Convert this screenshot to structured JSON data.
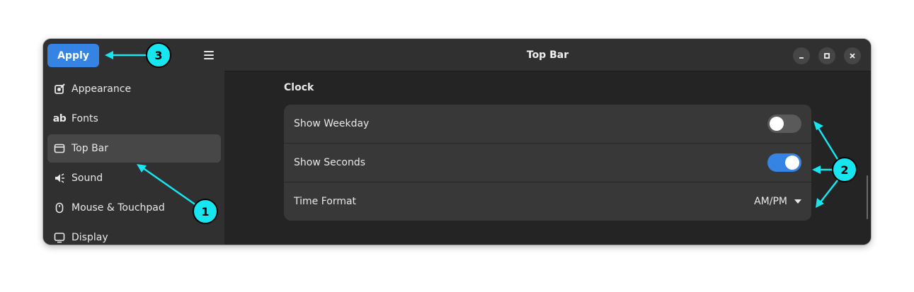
{
  "sidebar": {
    "apply_label": "Apply",
    "menu_icon": "hamburger-menu-icon",
    "items": [
      {
        "label": "Appearance",
        "icon": "appearance-icon"
      },
      {
        "label": "Fonts",
        "icon": "fonts-icon",
        "glyph": "ab"
      },
      {
        "label": "Top Bar",
        "icon": "top-bar-icon",
        "active": true
      },
      {
        "label": "Sound",
        "icon": "sound-icon"
      },
      {
        "label": "Mouse & Touchpad",
        "icon": "mouse-icon"
      },
      {
        "label": "Display",
        "icon": "display-icon"
      }
    ]
  },
  "header": {
    "title": "Top Bar",
    "controls": [
      "minimize-icon",
      "maximize-icon",
      "close-icon"
    ]
  },
  "content": {
    "section_title": "Clock",
    "rows": [
      {
        "label": "Show Weekday",
        "type": "switch",
        "state": "off"
      },
      {
        "label": "Show Seconds",
        "type": "switch",
        "state": "on"
      },
      {
        "label": "Time Format",
        "type": "dropdown",
        "value": "AM/PM"
      }
    ]
  },
  "annotations": {
    "callouts": [
      "1",
      "2",
      "3"
    ],
    "color": "#17e6f0"
  },
  "colors": {
    "accent": "#3584e4",
    "window_bg": "#242424",
    "sidebar_bg": "#303030",
    "row_bg": "#383838",
    "annotation": "#17e6f0"
  }
}
